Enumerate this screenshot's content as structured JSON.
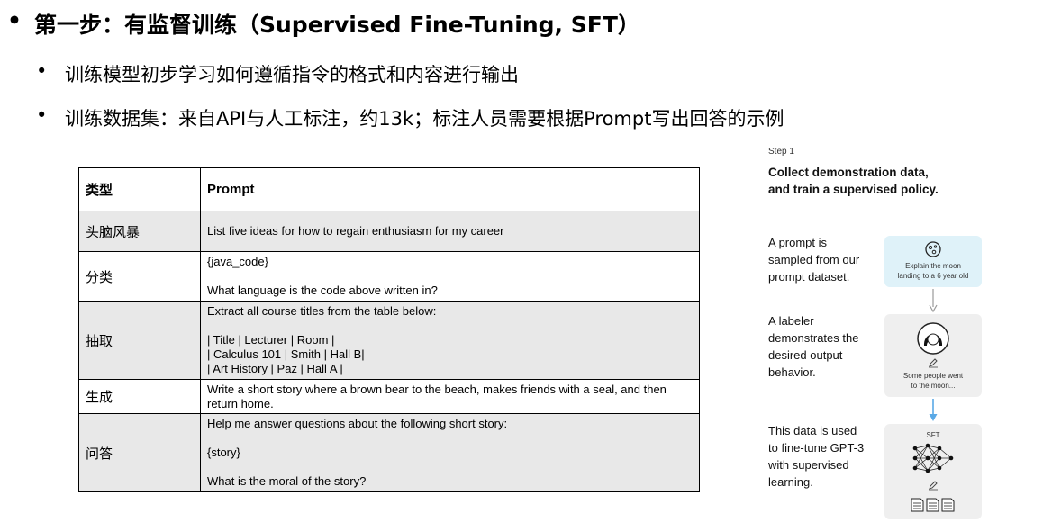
{
  "heading": {
    "bullet": "•",
    "text": "第一步：有监督训练（Supervised Fine-Tuning, SFT）"
  },
  "subpoints": [
    {
      "bullet": "•",
      "text": "训练模型初步学习如何遵循指令的格式和内容进行输出"
    },
    {
      "bullet": "•",
      "text": "训练数据集：来自API与人工标注，约13k；标注人员需要根据Prompt写出回答的示例"
    }
  ],
  "table": {
    "headers": [
      "类型",
      "Prompt"
    ],
    "rows": [
      {
        "type": "头脑风暴",
        "prompt_lines": [
          "List five ideas for how to regain enthusiasm for my career"
        ]
      },
      {
        "type": "分类",
        "prompt_lines": [
          "{java_code}",
          "",
          "What language is the code above written in?"
        ]
      },
      {
        "type": "抽取",
        "prompt_lines": [
          "Extract all course titles from the table below:",
          "",
          "| Title | Lecturer | Room |",
          "| Calculus 101 | Smith | Hall B|",
          "| Art History | Paz | Hall A |"
        ]
      },
      {
        "type": "生成",
        "prompt_lines": [
          "Write a short story where a brown bear to the beach, makes friends with a seal, and then return home."
        ]
      },
      {
        "type": "问答",
        "prompt_lines": [
          "Help me answer questions about the following short story:",
          "",
          "{story}",
          "",
          "What is the moral of the story?"
        ]
      }
    ]
  },
  "panel": {
    "step_label": "Step 1",
    "title_lines": [
      "Collect demonstration data,",
      "and train a supervised policy."
    ],
    "steps": [
      {
        "desc_lines": [
          "A prompt is",
          "sampled from our",
          "prompt dataset."
        ],
        "card_lines": [
          "Explain the moon",
          "landing to a 6 year old"
        ],
        "icon": "moon-icon"
      },
      {
        "desc_lines": [
          "A labeler",
          "demonstrates the",
          "desired output",
          "behavior."
        ],
        "card_lines": [
          "Some people went",
          "to the moon..."
        ],
        "icon": "labeler-avatar-icon"
      },
      {
        "desc_lines": [
          "This data is used",
          "to fine-tune GPT-3",
          "with supervised",
          "learning."
        ],
        "card_label": "SFT",
        "icon": "neural-network-icon"
      }
    ],
    "colors": {
      "prompt_card": "#dff2f9",
      "card": "#efefef",
      "arrow_blue": "#5aa9e6",
      "arrow_gray": "#999999"
    }
  }
}
